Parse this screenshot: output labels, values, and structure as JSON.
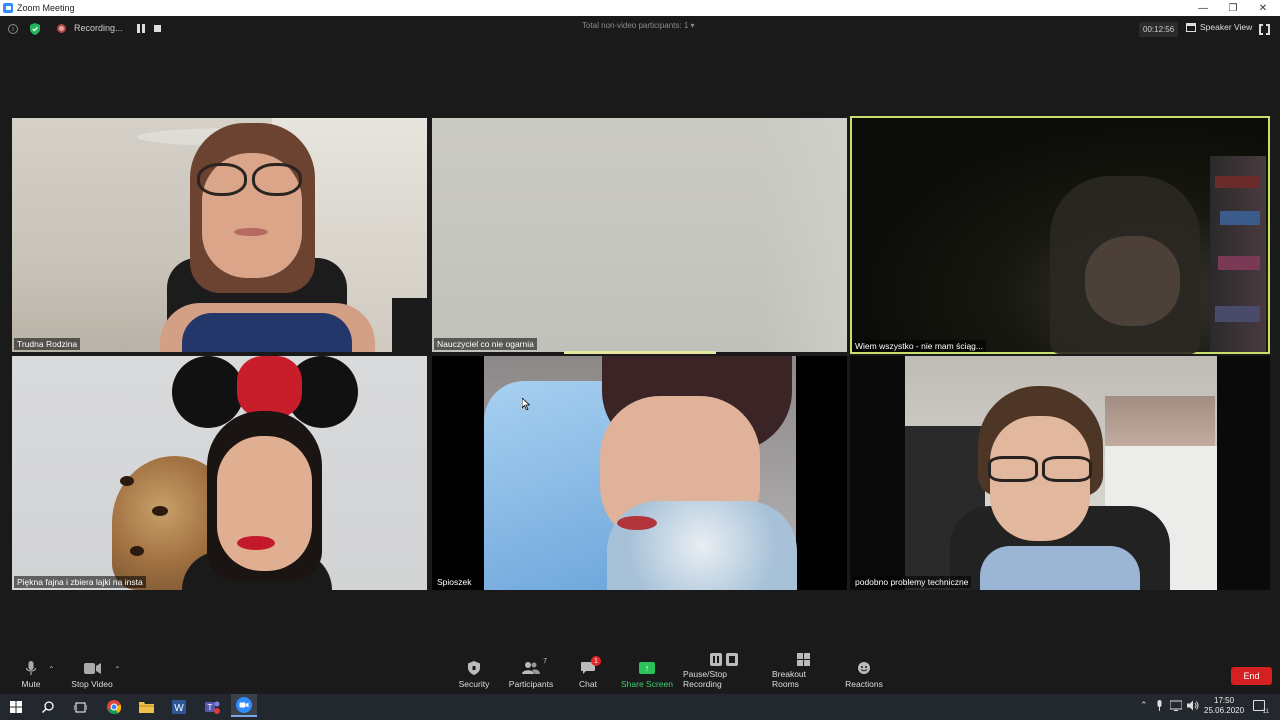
{
  "window": {
    "title": "Zoom Meeting",
    "controls": {
      "minimize": "—",
      "restore": "❐",
      "close": "✕"
    }
  },
  "topbar": {
    "recording_label": "Recording...",
    "non_video_participants": "Total non-video participants: 1 ▾",
    "meeting_timer": "00:12:56",
    "view_label": "Speaker View"
  },
  "participants": [
    {
      "name": "Trudna Rodzina"
    },
    {
      "name": "Nauczyciel co nie ogarnia"
    },
    {
      "name": "Wiem wszystko - nie mam ściąg..."
    },
    {
      "name": "Piękna fajna i zbiera lajki na insta"
    },
    {
      "name": "Spioszek"
    },
    {
      "name": "podobno problemy techniczne"
    }
  ],
  "toolbar": {
    "mute": "Mute",
    "stop_video": "Stop Video",
    "security": "Security",
    "participants": "Participants",
    "participants_count": "7",
    "chat": "Chat",
    "chat_badge": "1",
    "share_screen": "Share Screen",
    "pause_stop_recording": "Pause/Stop Recording",
    "breakout_rooms": "Breakout Rooms",
    "reactions": "Reactions",
    "end": "End"
  },
  "taskbar": {
    "time": "17:50",
    "date": "25.06.2020",
    "notifications": "11"
  },
  "colors": {
    "zoom_blue": "#2d8cff",
    "share_green": "#2cc25a",
    "end_red": "#d42020",
    "active_speaker": "#c8e06a"
  }
}
